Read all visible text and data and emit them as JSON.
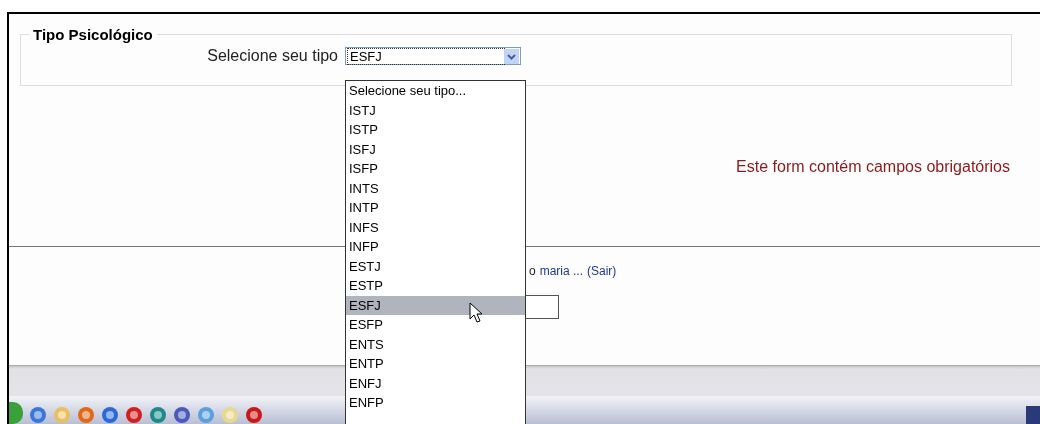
{
  "section": {
    "legend": "Tipo Psicológico",
    "label": "Selecione seu tipo",
    "select": {
      "value": "ESFJ",
      "expanded": true,
      "options": [
        {
          "label": "Selecione seu tipo...",
          "selected": false
        },
        {
          "label": "ISTJ",
          "selected": false
        },
        {
          "label": "ISTP",
          "selected": false
        },
        {
          "label": "ISFJ",
          "selected": false
        },
        {
          "label": "ISFP",
          "selected": false
        },
        {
          "label": "INTS",
          "selected": false
        },
        {
          "label": "INTP",
          "selected": false
        },
        {
          "label": "INFS",
          "selected": false
        },
        {
          "label": "INFP",
          "selected": false
        },
        {
          "label": "ESTJ",
          "selected": false
        },
        {
          "label": "ESTP",
          "selected": false
        },
        {
          "label": "ESFJ",
          "selected": true
        },
        {
          "label": "ESFP",
          "selected": false
        },
        {
          "label": "ENTS",
          "selected": false
        },
        {
          "label": "ENTP",
          "selected": false
        },
        {
          "label": "ENFJ",
          "selected": false
        },
        {
          "label": "ENFP",
          "selected": false
        }
      ]
    }
  },
  "notice": "Este form contém campos obrigatórios",
  "login": {
    "prefix": "o",
    "user": "maria ...",
    "logout": "(Sair)"
  }
}
